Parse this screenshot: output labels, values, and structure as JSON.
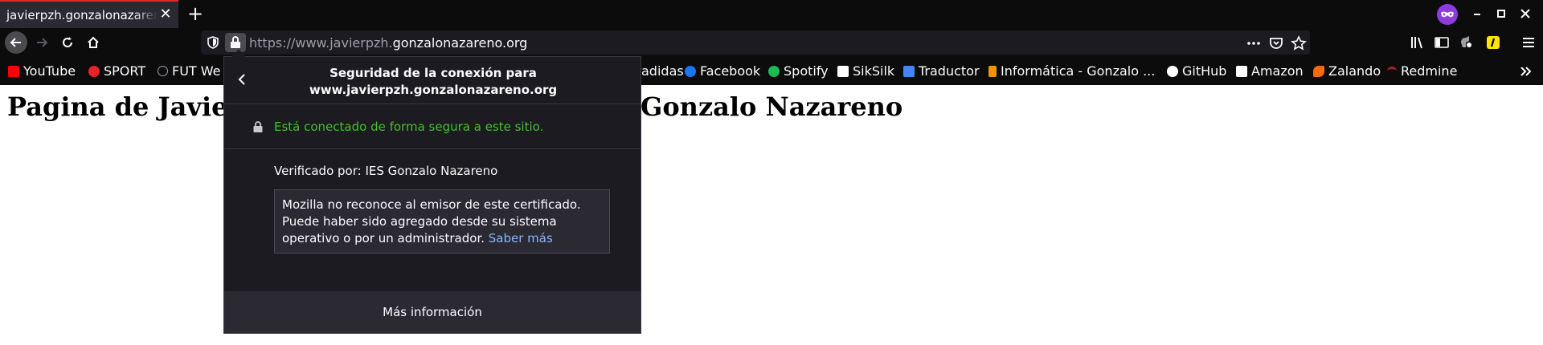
{
  "tab": {
    "title": "javierpzh.gonzalonazareno.org"
  },
  "url": {
    "prefix": "https://www.javierpzh.",
    "domain": "gonzalonazareno.org"
  },
  "bookmarks": [
    {
      "label": "YouTube",
      "color": "#ff0000"
    },
    {
      "label": "SPORT",
      "color": "#e3242b"
    },
    {
      "label": "FUT We",
      "color": "#9e9ea6"
    },
    {
      "label": "adidas",
      "color": "#ffffff"
    },
    {
      "label": "Facebook",
      "color": "#1877f2"
    },
    {
      "label": "Spotify",
      "color": "#1db954"
    },
    {
      "label": "SikSilk",
      "color": "#ffffff"
    },
    {
      "label": "Traductor",
      "color": "#4285f4"
    },
    {
      "label": "Informática - Gonzalo ...",
      "color": "#f39200"
    },
    {
      "label": "GitHub",
      "color": "#ffffff"
    },
    {
      "label": "Amazon",
      "color": "#ffffff"
    },
    {
      "label": "Zalando",
      "color": "#ff6900"
    },
    {
      "label": "Redmine",
      "color": "#b32024"
    }
  ],
  "page": {
    "heading_left": "Pagina de Javie",
    "heading_right": "Gonzalo Nazareno"
  },
  "popup": {
    "title_line1": "Seguridad de la conexión para",
    "title_line2": "www.javierpzh.gonzalonazareno.org",
    "secure_text": "Está conectado de forma segura a este sitio.",
    "verified": "Verificado por: IES Gonzalo Nazareno",
    "warning_text": "Mozilla no reconoce al emisor de este certificado. Puede haber sido agregado desde su sistema operativo o por un administrador.",
    "learn_more": "Saber más",
    "more_info": "Más información"
  },
  "colors": {
    "secure_green": "#43c12b",
    "accent_tab": "#e3242b",
    "private_purple": "#8f3bdb"
  }
}
